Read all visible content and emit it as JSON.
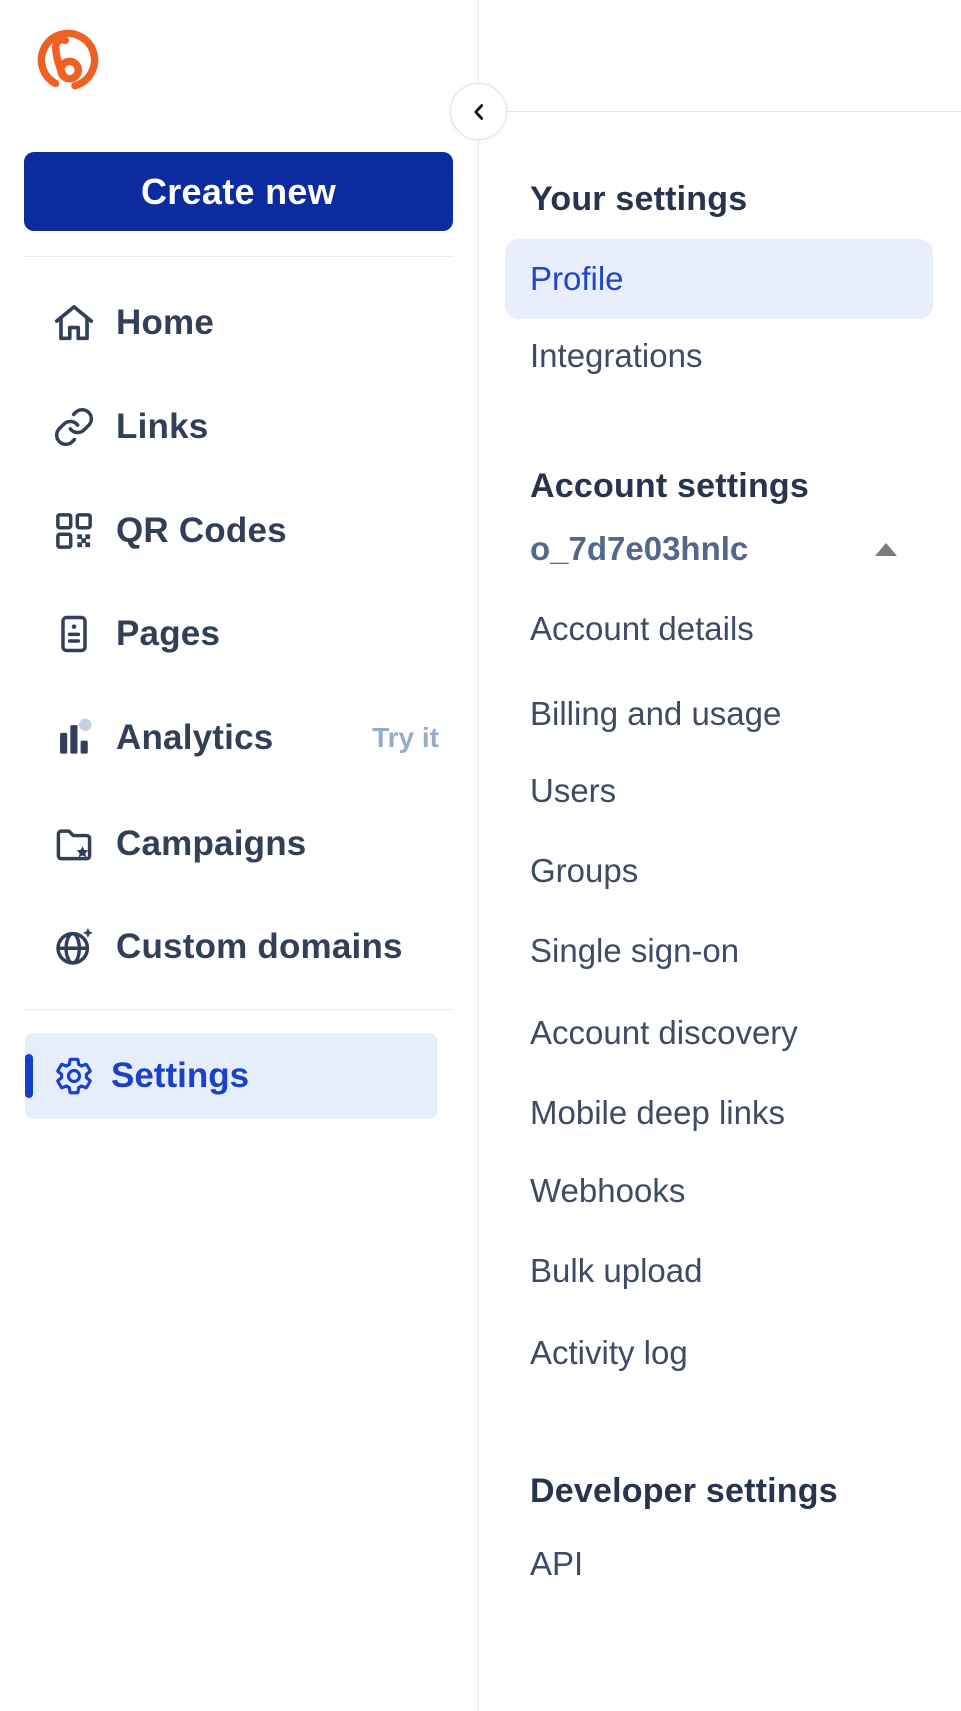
{
  "app": "Bitly",
  "colors": {
    "brand_orange": "#ee6123",
    "primary_button_blue": "#0c2ba1",
    "accent_blue": "#1b41c8",
    "active_row_bg": "#e7eefb",
    "nav_text": "#333e58",
    "panel_text": "#3f4b66",
    "heading_text": "#28334e",
    "muted_badge": "#9aabc8",
    "org_text": "#55678a"
  },
  "sidebar": {
    "logo": "bitly-logo",
    "create_button": "Create new",
    "items": [
      {
        "label": "Home",
        "icon": "home-icon"
      },
      {
        "label": "Links",
        "icon": "link-icon"
      },
      {
        "label": "QR Codes",
        "icon": "qr-code-icon"
      },
      {
        "label": "Pages",
        "icon": "pages-icon"
      },
      {
        "label": "Analytics",
        "icon": "bar-chart-icon",
        "badge": "Try it"
      },
      {
        "label": "Campaigns",
        "icon": "folder-star-icon"
      },
      {
        "label": "Custom domains",
        "icon": "globe-icon"
      },
      {
        "label": "Settings",
        "icon": "gear-icon",
        "active": true
      }
    ]
  },
  "panel": {
    "collapse_button_icon": "chevron-left-icon",
    "sections": [
      {
        "heading": "Your settings",
        "items": [
          {
            "label": "Profile",
            "active": true
          },
          {
            "label": "Integrations"
          }
        ]
      },
      {
        "heading": "Account settings",
        "org_selector": {
          "value": "o_7d7e03hnlc",
          "icon": "caret-up-icon"
        },
        "items": [
          {
            "label": "Account details"
          },
          {
            "label": "Billing and usage"
          },
          {
            "label": "Users"
          },
          {
            "label": "Groups"
          },
          {
            "label": "Single sign-on"
          },
          {
            "label": "Account discovery"
          },
          {
            "label": "Mobile deep links"
          },
          {
            "label": "Webhooks"
          },
          {
            "label": "Bulk upload"
          },
          {
            "label": "Activity log"
          }
        ]
      },
      {
        "heading": "Developer settings",
        "items": [
          {
            "label": "API"
          }
        ]
      }
    ]
  }
}
